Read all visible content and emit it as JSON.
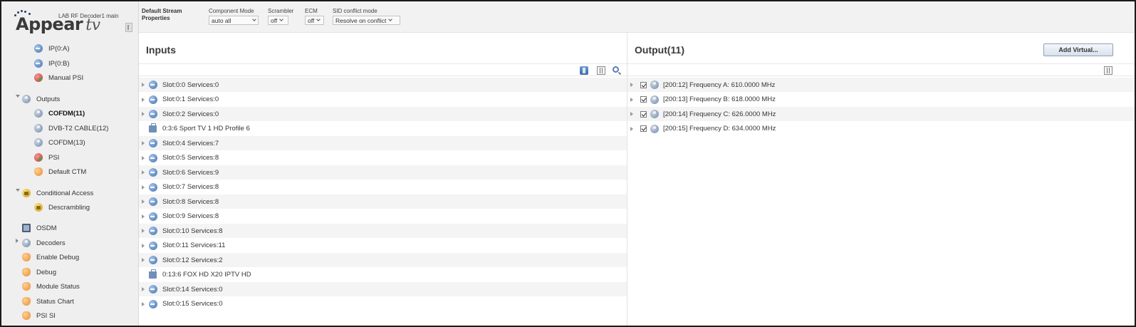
{
  "app": {
    "logo": "Appear",
    "logo_suffix": "tv",
    "device_name": "LAB RF Decoder1 main"
  },
  "stream_properties": {
    "title_line1": "Default Stream",
    "title_line2": "Properties",
    "component_mode": {
      "label": "Component Mode",
      "value": "auto all"
    },
    "scrambler": {
      "label": "Scrambler",
      "value": "off"
    },
    "ecm": {
      "label": "ECM",
      "value": "off"
    },
    "sid_conflict": {
      "label": "SID conflict mode",
      "value": "Resolve on conflict"
    }
  },
  "sidebar": {
    "items": [
      {
        "label": "IP(0:A)",
        "icon": "input-icon",
        "level": 1
      },
      {
        "label": "IP(0:B)",
        "icon": "input-icon",
        "level": 1
      },
      {
        "label": "Manual PSI",
        "icon": "psi-icon",
        "level": 1
      },
      {
        "label": "Outputs",
        "icon": "output-icon",
        "level": 0,
        "expanded": true
      },
      {
        "label": "COFDM(11)",
        "icon": "output-icon",
        "level": 1,
        "active": true
      },
      {
        "label": "DVB-T2 CABLE(12)",
        "icon": "output-icon",
        "level": 1
      },
      {
        "label": "COFDM(13)",
        "icon": "output-icon",
        "level": 1
      },
      {
        "label": "PSI",
        "icon": "psi-icon",
        "level": 1
      },
      {
        "label": "Default CTM",
        "icon": "orange-icon",
        "level": 1
      },
      {
        "label": "Conditional Access",
        "icon": "lock-icon",
        "level": 0,
        "expanded": true
      },
      {
        "label": "Descrambling",
        "icon": "lock-icon",
        "level": 1
      },
      {
        "label": "OSDM",
        "icon": "osdm-icon",
        "level": 0
      },
      {
        "label": "Decoders",
        "icon": "output-icon",
        "level": 0,
        "expanded": false
      },
      {
        "label": "Enable Debug",
        "icon": "orange-icon",
        "level": 0
      },
      {
        "label": "Debug",
        "icon": "orange-icon",
        "level": 0
      },
      {
        "label": "Module Status",
        "icon": "orange-icon",
        "level": 0
      },
      {
        "label": "Status Chart",
        "icon": "orange-icon",
        "level": 0
      },
      {
        "label": "PSI SI",
        "icon": "orange-icon",
        "level": 0
      }
    ]
  },
  "inputs": {
    "title": "Inputs",
    "rows": [
      {
        "label": "Slot:0:0 Services:0",
        "type": "slot"
      },
      {
        "label": "Slot:0:1 Services:0",
        "type": "slot"
      },
      {
        "label": "Slot:0:2 Services:0",
        "type": "slot"
      },
      {
        "label": "0:3:6 Sport TV 1 HD Profile 6",
        "type": "service"
      },
      {
        "label": "Slot:0:4 Services:7",
        "type": "slot"
      },
      {
        "label": "Slot:0:5 Services:8",
        "type": "slot"
      },
      {
        "label": "Slot:0:6 Services:9",
        "type": "slot"
      },
      {
        "label": "Slot:0:7 Services:8",
        "type": "slot"
      },
      {
        "label": "Slot:0:8 Services:8",
        "type": "slot"
      },
      {
        "label": "Slot:0:9 Services:8",
        "type": "slot"
      },
      {
        "label": "Slot:0:10 Services:8",
        "type": "slot"
      },
      {
        "label": "Slot:0:11 Services:11",
        "type": "slot"
      },
      {
        "label": "Slot:0:12 Services:2",
        "type": "slot"
      },
      {
        "label": "0:13:6 FOX HD X20 IPTV HD",
        "type": "service"
      },
      {
        "label": "Slot:0:14 Services:0",
        "type": "slot"
      },
      {
        "label": "Slot:0:15 Services:0",
        "type": "slot"
      }
    ]
  },
  "outputs": {
    "title": "Output(11)",
    "add_button": "Add Virtual...",
    "rows": [
      {
        "label": "[200:12] Frequency A: 610.0000 MHz",
        "checked": true
      },
      {
        "label": "[200:13] Frequency B: 618.0000 MHz",
        "checked": true
      },
      {
        "label": "[200:14] Frequency C: 626.0000 MHz",
        "checked": true
      },
      {
        "label": "[200:15] Frequency D: 634.0000 MHz",
        "checked": true
      }
    ]
  }
}
